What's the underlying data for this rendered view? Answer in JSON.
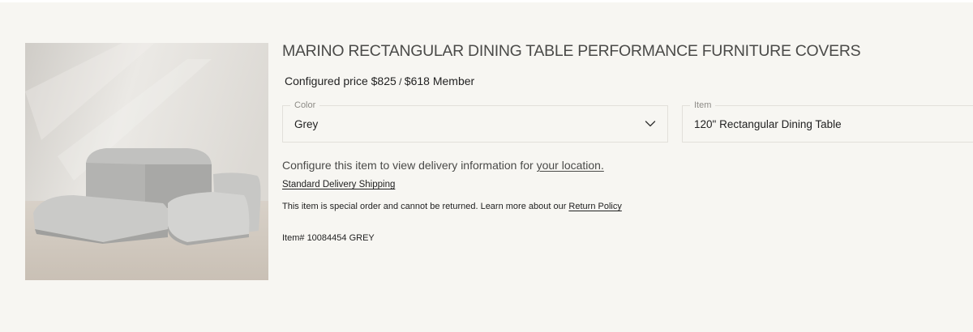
{
  "product": {
    "title": "MARINO RECTANGULAR DINING TABLE PERFORMANCE FURNITURE COVERS",
    "image_alt_name": "furniture covers product photo",
    "price_label": "Configured price",
    "price_regular": "$825",
    "price_separator": " / ",
    "price_member": "$618 Member"
  },
  "options": {
    "color": {
      "label": "Color",
      "value": "Grey",
      "icon": "chevron-down-icon"
    },
    "item": {
      "label": "Item",
      "value": "120\" Rectangular Dining Table"
    }
  },
  "delivery": {
    "text": "Configure this item to view delivery information for ",
    "link": "your location."
  },
  "shipping": {
    "link": "Standard Delivery Shipping"
  },
  "returns": {
    "text": "This item is special order and cannot be returned. Learn more about our ",
    "link": "Return Policy"
  },
  "item_number": "Item# 10084454 GREY",
  "colors": {
    "background": "#f7f6f2",
    "text": "#222222",
    "muted": "#8d8b86",
    "border": "#e2e0da"
  }
}
